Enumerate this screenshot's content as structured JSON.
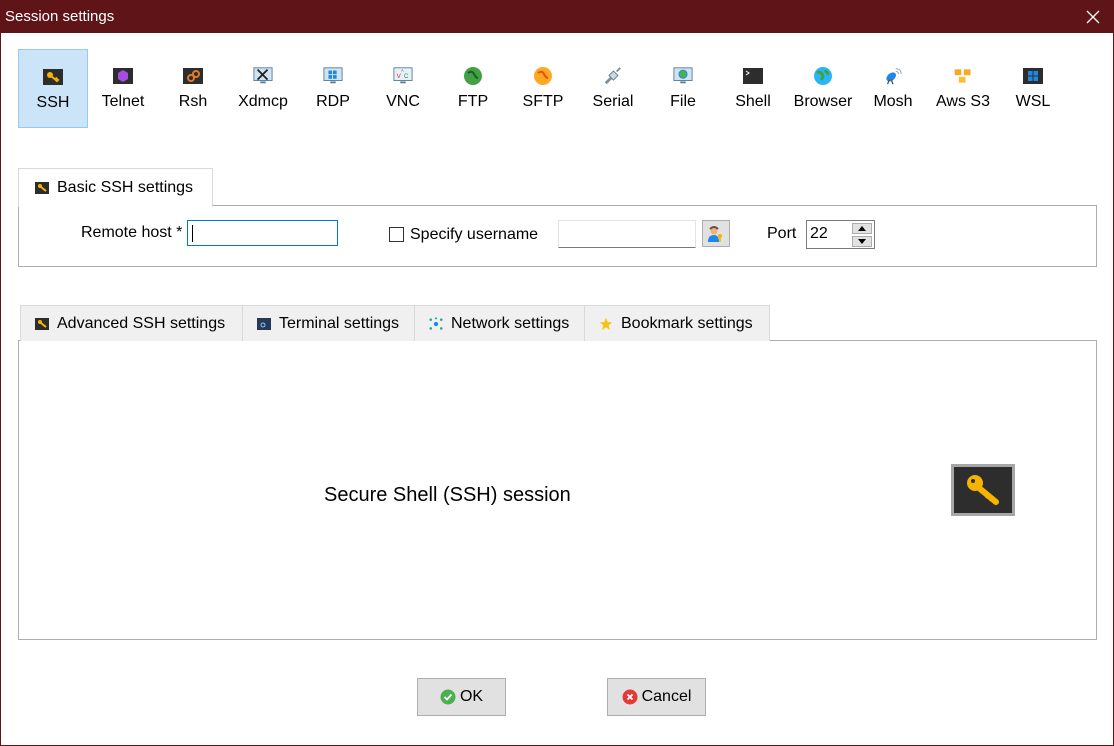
{
  "window": {
    "title": "Session settings",
    "close_icon": "close-icon"
  },
  "session_types": [
    {
      "label": "SSH",
      "icon": "ssh-key-icon",
      "selected": true
    },
    {
      "label": "Telnet",
      "icon": "telnet-icon",
      "selected": false
    },
    {
      "label": "Rsh",
      "icon": "rsh-icon",
      "selected": false
    },
    {
      "label": "Xdmcp",
      "icon": "xdmcp-icon",
      "selected": false
    },
    {
      "label": "RDP",
      "icon": "rdp-icon",
      "selected": false
    },
    {
      "label": "VNC",
      "icon": "vnc-icon",
      "selected": false
    },
    {
      "label": "FTP",
      "icon": "ftp-globe-icon",
      "selected": false
    },
    {
      "label": "SFTP",
      "icon": "sftp-globe-icon",
      "selected": false
    },
    {
      "label": "Serial",
      "icon": "serial-plug-icon",
      "selected": false
    },
    {
      "label": "File",
      "icon": "file-monitor-icon",
      "selected": false
    },
    {
      "label": "Shell",
      "icon": "shell-terminal-icon",
      "selected": false
    },
    {
      "label": "Browser",
      "icon": "browser-globe-icon",
      "selected": false
    },
    {
      "label": "Mosh",
      "icon": "mosh-satellite-icon",
      "selected": false
    },
    {
      "label": "Aws S3",
      "icon": "aws-s3-cubes-icon",
      "selected": false
    },
    {
      "label": "WSL",
      "icon": "wsl-windows-icon",
      "selected": false
    }
  ],
  "basic": {
    "tab_label": "Basic SSH settings",
    "remote_host_label": "Remote host *",
    "remote_host_value": "",
    "specify_username_label": "Specify username",
    "specify_username_checked": false,
    "username_value": "",
    "port_label": "Port",
    "port_value": "22"
  },
  "advanced_tabs": [
    {
      "label": "Advanced SSH settings",
      "icon": "ssh-key-icon"
    },
    {
      "label": "Terminal settings",
      "icon": "terminal-icon"
    },
    {
      "label": "Network settings",
      "icon": "network-icon"
    },
    {
      "label": "Bookmark settings",
      "icon": "star-icon"
    }
  ],
  "panel": {
    "description": "Secure Shell (SSH) session"
  },
  "footer": {
    "ok_label": "OK",
    "cancel_label": "Cancel"
  },
  "colors": {
    "titlebar": "#5f1517",
    "selected_bg": "#cce4f7",
    "focus_border": "#0078d7"
  }
}
